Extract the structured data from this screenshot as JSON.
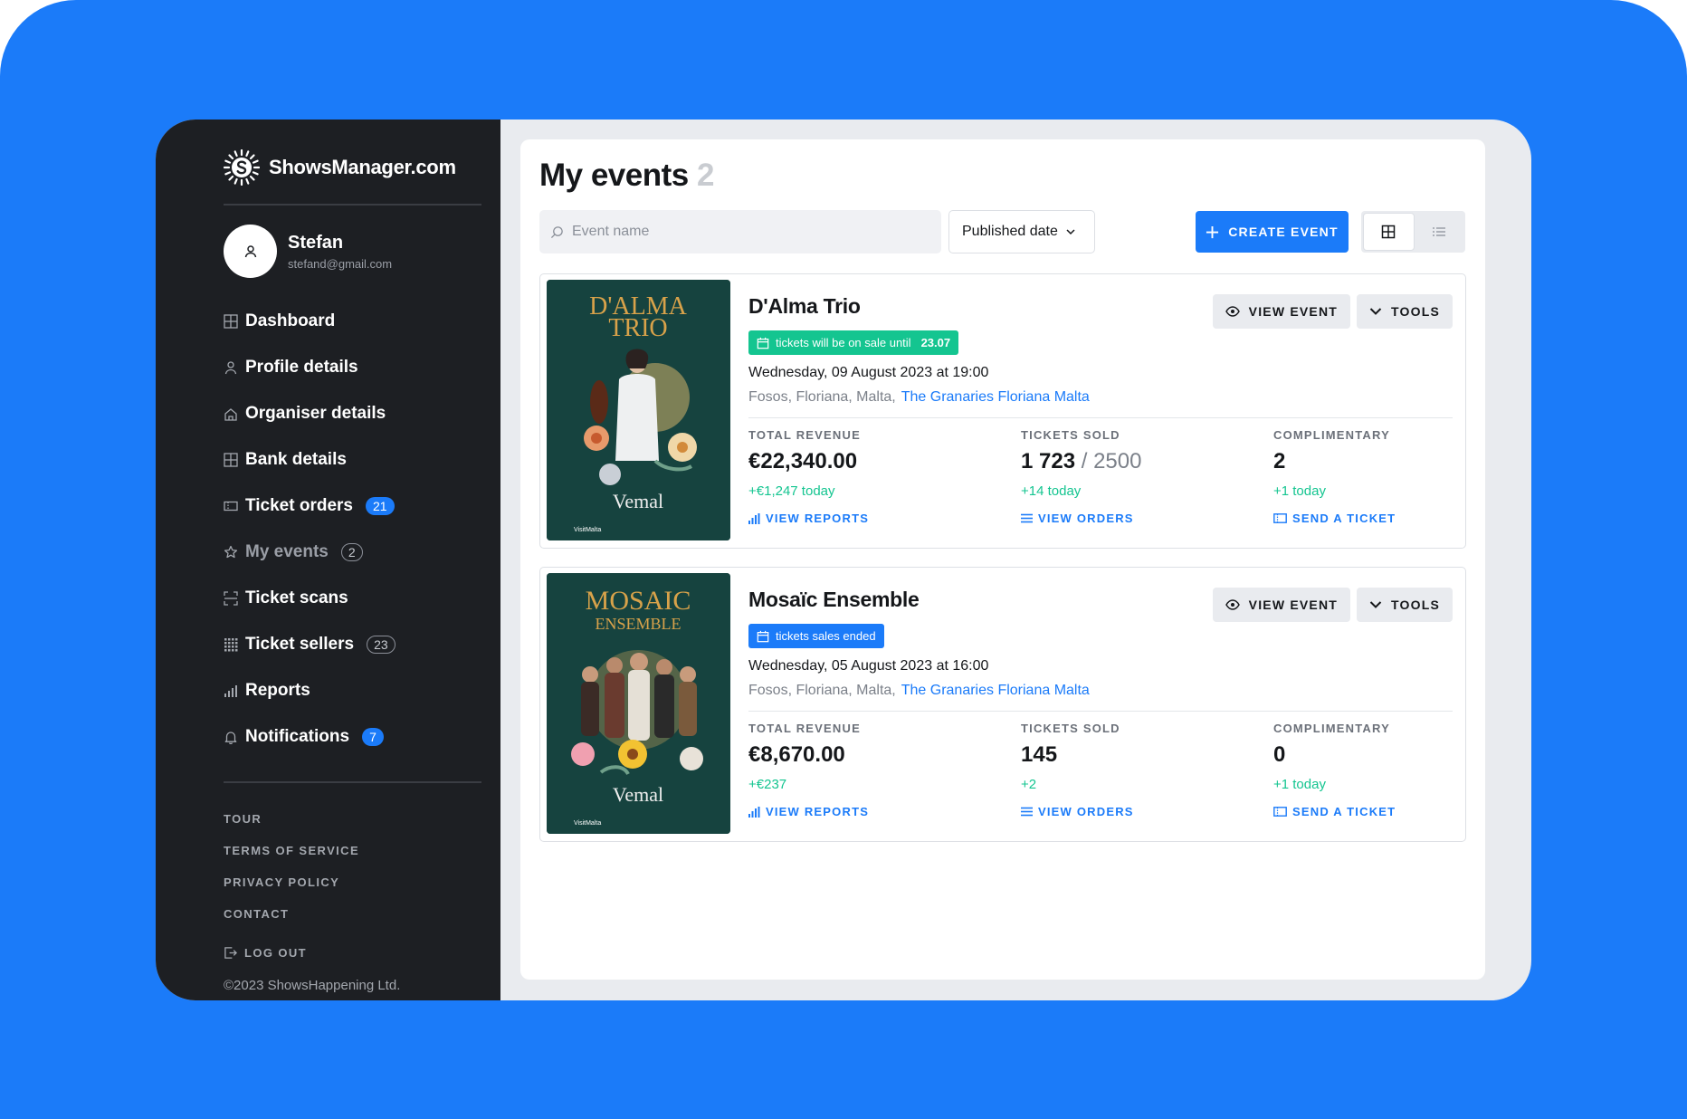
{
  "brand": {
    "name": "ShowsManager.com"
  },
  "user": {
    "name": "Stefan",
    "email": "stefand@gmail.com"
  },
  "nav": [
    {
      "label": "Dashboard",
      "icon": "grid-icon"
    },
    {
      "label": "Profile details",
      "icon": "user-icon"
    },
    {
      "label": "Organiser details",
      "icon": "home-icon"
    },
    {
      "label": "Bank details",
      "icon": "bank-icon"
    },
    {
      "label": "Ticket orders",
      "icon": "ticket-icon",
      "badge": "21"
    },
    {
      "label": "My events",
      "icon": "star-icon",
      "badge": "2"
    },
    {
      "label": "Ticket scans",
      "icon": "scan-icon"
    },
    {
      "label": "Ticket sellers",
      "icon": "dots-grid-icon",
      "badge": "23"
    },
    {
      "label": "Reports",
      "icon": "bar-chart-icon"
    },
    {
      "label": "Notifications",
      "icon": "bell-icon",
      "badge": "7"
    }
  ],
  "footer": {
    "tour": "TOUR",
    "terms": "TERMS OF SERVICE",
    "privacy": "PRIVACY POLICY",
    "contact": "CONTACT",
    "logout": "LOG OUT",
    "copyright": "©2023 ShowsHappening Ltd."
  },
  "page": {
    "title": "My events",
    "count": "2"
  },
  "toolbar": {
    "search_placeholder": "Event name",
    "sort_label": "Published date",
    "create_label": "CREATE EVENT"
  },
  "events": [
    {
      "title": "D'Alma Trio",
      "status": "tickets will be on sale until",
      "status_date": "23.07",
      "date": "Wednesday, 09 August 2023 at 19:00",
      "location": "Fosos, Floriana, Malta,",
      "venue": "The Granaries Floriana Malta",
      "view_label": "VIEW EVENT",
      "tools_label": "TOOLS",
      "poster_title_1": "D'ALMA",
      "poster_title_2": "TRIO",
      "poster_brand": "Vemal",
      "poster_sponsor": "VisitMalta",
      "revenue_label": "TOTAL REVENUE",
      "revenue": "€22,340.00",
      "revenue_delta": "+€1,247 today",
      "reports_label": "VIEW REPORTS",
      "sold_label": "TICKETS SOLD",
      "sold": "1 723",
      "sold_total": "/ 2500",
      "sold_delta": "+14 today",
      "orders_label": "VIEW ORDERS",
      "comp_label": "COMPLIMENTARY",
      "comp": "2",
      "comp_delta": "+1 today",
      "send_label": "SEND A TICKET"
    },
    {
      "title": "Mosaïc Ensemble",
      "status": "tickets sales ended",
      "status_date": "",
      "date": "Wednesday, 05 August 2023 at 16:00",
      "location": "Fosos, Floriana, Malta,",
      "venue": "The Granaries Floriana Malta",
      "view_label": "VIEW EVENT",
      "tools_label": "TOOLS",
      "poster_title_1": "MOSAIC",
      "poster_title_2": "ENSEMBLE",
      "poster_brand": "Vemal",
      "poster_sponsor": "VisitMalta",
      "revenue_label": "TOTAL REVENUE",
      "revenue": "€8,670.00",
      "revenue_delta": "+€237",
      "reports_label": "VIEW REPORTS",
      "sold_label": "TICKETS SOLD",
      "sold": "145",
      "sold_total": "",
      "sold_delta": "+2",
      "orders_label": "VIEW ORDERS",
      "comp_label": "COMPLIMENTARY",
      "comp": "0",
      "comp_delta": "+1 today",
      "send_label": "SEND A TICKET"
    }
  ],
  "colors": {
    "accent": "#1b7bf9",
    "success": "#14c590",
    "sidebar": "#1d1f23"
  }
}
